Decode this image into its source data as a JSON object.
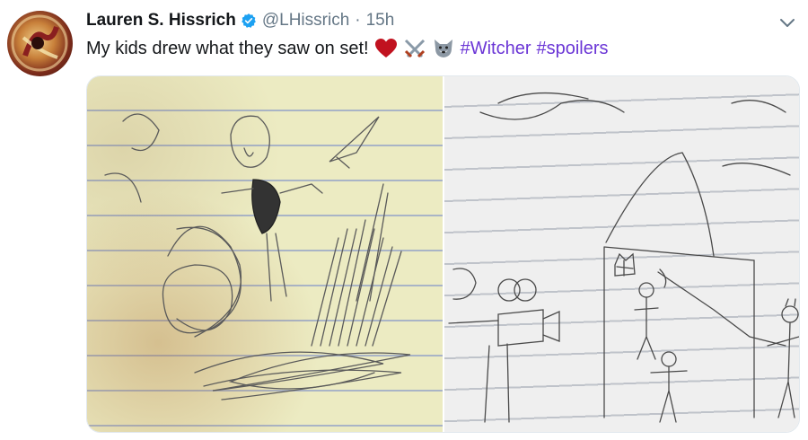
{
  "tweet": {
    "display_name": "Lauren S. Hissrich",
    "handle": "@LHissrich",
    "separator": "·",
    "time": "15h",
    "text": "My kids drew what they saw on set!",
    "hashtags": [
      "#Witcher",
      "#spoilers"
    ],
    "emojis": [
      "red-heart",
      "crossed-swords",
      "wolf-face"
    ]
  },
  "icons": {
    "verified": "verified-badge-icon",
    "menu": "chevron-down-icon"
  },
  "colors": {
    "hashtag": "#6b36d6",
    "verified": "#1da1f2",
    "secondary_text": "#657786"
  },
  "media": {
    "photos": [
      {
        "name": "left-drawing"
      },
      {
        "name": "right-drawing"
      }
    ]
  }
}
